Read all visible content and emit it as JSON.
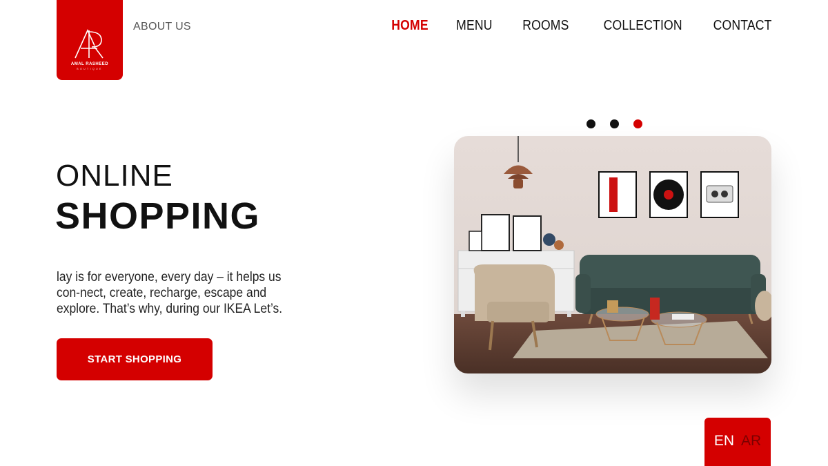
{
  "brand": {
    "name": "AMAL RASHEED",
    "sub": "BOUTIQUE",
    "monogram": "AR",
    "color": "#d40000"
  },
  "header": {
    "about": "ABOUT US",
    "nav": [
      {
        "label": "HOME",
        "active": true
      },
      {
        "label": "MENU",
        "active": false
      },
      {
        "label": "ROOMS",
        "active": false
      },
      {
        "label": "COLLECTION",
        "active": false
      },
      {
        "label": "CONTACT",
        "active": false
      }
    ]
  },
  "hero": {
    "title_line1": "ONLINE",
    "title_line2": "SHOPPING",
    "description": "lay is for everyone, every day – it helps us con-nect, create, recharge, escape and explore. That’s why, during our IKEA Let’s.",
    "cta": "START SHOPPING",
    "carousel": {
      "count": 3,
      "active_index": 2
    }
  },
  "language": {
    "en": "EN",
    "ar": "AR",
    "selected": "EN"
  },
  "colors": {
    "accent": "#d40000",
    "text": "#111111"
  }
}
